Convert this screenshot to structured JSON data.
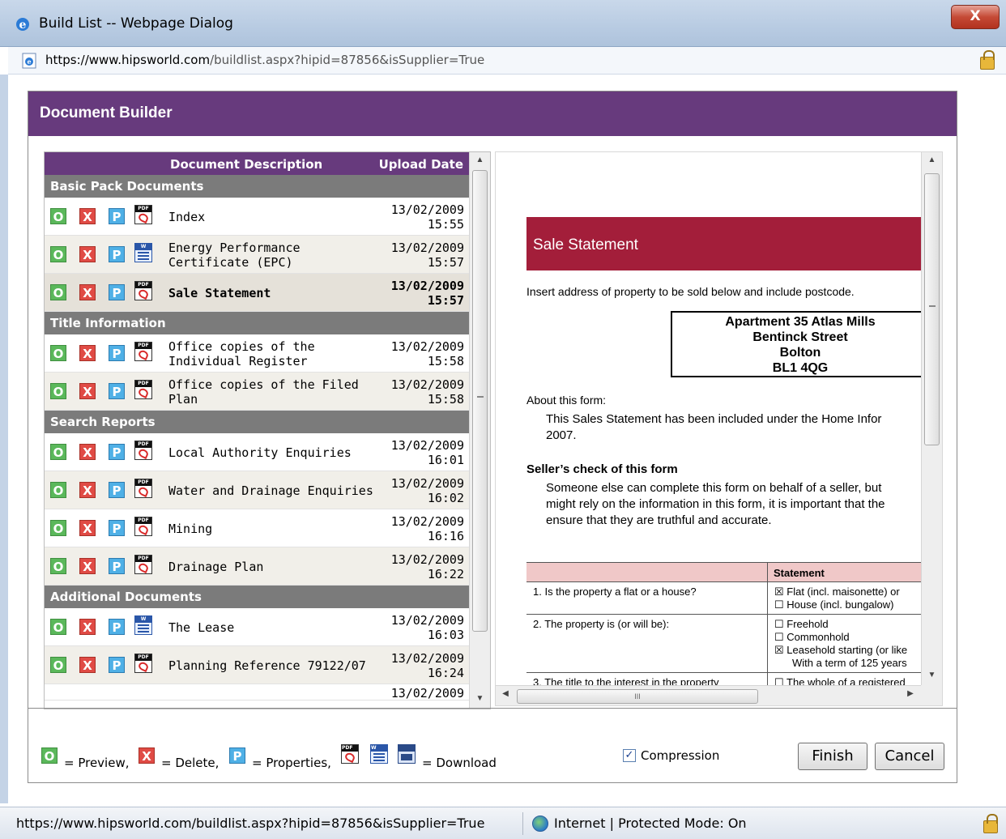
{
  "window": {
    "title": "Build List -- Webpage Dialog",
    "close_label": "X",
    "address_url_domain": "https://www.hipsworld.com",
    "address_url_rest": "/buildlist.aspx?hipid=87856&isSupplier=True"
  },
  "dialog": {
    "title": "Document Builder"
  },
  "list": {
    "col_description": "Document Description",
    "col_date": "Upload Date",
    "icon_labels": {
      "preview": "O",
      "delete": "X",
      "properties": "P",
      "pdf": "PDF",
      "word": "W"
    },
    "sections": [
      {
        "title": "Basic Pack Documents",
        "rows": [
          {
            "name": "Index",
            "date": "13/02/2009",
            "time": "15:55",
            "file_type": "pdf"
          },
          {
            "name": "Energy Performance Certificate (EPC)",
            "date": "13/02/2009",
            "time": "15:57",
            "file_type": "word"
          },
          {
            "name": "Sale Statement",
            "date": "13/02/2009",
            "time": "15:57",
            "file_type": "pdf",
            "selected": true
          }
        ]
      },
      {
        "title": "Title Information",
        "rows": [
          {
            "name": "Office copies of the Individual Register",
            "date": "13/02/2009",
            "time": "15:58",
            "file_type": "pdf"
          },
          {
            "name": "Office copies of the Filed Plan",
            "date": "13/02/2009",
            "time": "15:58",
            "file_type": "pdf"
          }
        ]
      },
      {
        "title": "Search Reports",
        "rows": [
          {
            "name": "Local Authority Enquiries",
            "date": "13/02/2009",
            "time": "16:01",
            "file_type": "pdf"
          },
          {
            "name": "Water and Drainage Enquiries",
            "date": "13/02/2009",
            "time": "16:02",
            "file_type": "pdf"
          },
          {
            "name": "Mining",
            "date": "13/02/2009",
            "time": "16:16",
            "file_type": "pdf"
          },
          {
            "name": "Drainage Plan",
            "date": "13/02/2009",
            "time": "16:22",
            "file_type": "pdf"
          }
        ]
      },
      {
        "title": "Additional Documents",
        "rows": [
          {
            "name": "The Lease",
            "date": "13/02/2009",
            "time": "16:03",
            "file_type": "word"
          },
          {
            "name": "Planning Reference 79122/07",
            "date": "13/02/2009",
            "time": "16:24",
            "file_type": "pdf"
          }
        ]
      }
    ],
    "partial_row_date": "13/02/2009"
  },
  "preview": {
    "banner": "Sale Statement",
    "instruction": "Insert address of property to be sold below and include postcode.",
    "address_lines": [
      "Apartment 35 Atlas Mills",
      "Bentinck Street",
      "Bolton",
      "BL1 4QG"
    ],
    "about_heading": "About this form:",
    "about_line1": "This Sales Statement has been included under the Home Infor",
    "about_line2": "2007.",
    "check_heading": "Seller’s check of this form",
    "check_line1": "Someone else can complete this form on behalf of a seller, but",
    "check_line2": "might rely on the information in this form, it is important that the",
    "check_line3": "ensure that they are truthful and accurate.",
    "table_header": "Statement",
    "q1": "1.   Is the property a flat or a house?",
    "q1_opt1": "☒  Flat (incl. maisonette) or",
    "q1_opt2": "☐  House (incl. bungalow)",
    "q2": "2.   The property is (or will be):",
    "q2_opt1": "☐  Freehold",
    "q2_opt2": "☐  Commonhold",
    "q2_opt3": "☒  Leasehold starting (or like",
    "q2_opt4": "With a term of 125 years",
    "q3": "3.   The title to the interest in the property",
    "q3_opt1": "☐  The whole of a registered"
  },
  "footer": {
    "preview_text": "= Preview,",
    "delete_text": "= Delete,",
    "properties_text": "= Properties,",
    "download_text": "= Download",
    "compression_label": "Compression",
    "compression_checked": true,
    "finish_label": "Finish",
    "cancel_label": "Cancel"
  },
  "statusbar": {
    "url": "https://www.hipsworld.com/buildlist.aspx?hipid=87856&isSupplier=True",
    "zone": "Internet | Protected Mode: On"
  },
  "colors": {
    "header_purple": "#673a7d",
    "section_gray": "#7b7b7b",
    "banner_red": "#a31e3a"
  }
}
